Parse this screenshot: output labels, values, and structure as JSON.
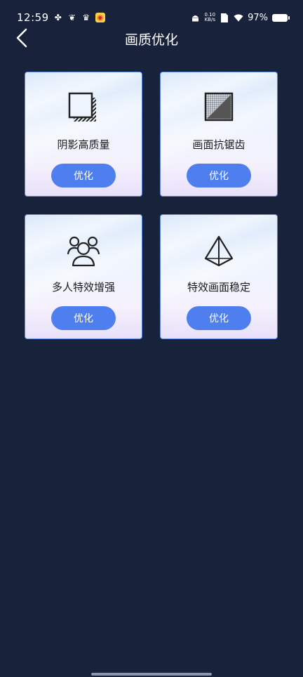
{
  "status_bar": {
    "time": "12:59",
    "net_speed_value": "0.10",
    "net_speed_unit": "KB/s",
    "battery": "97%"
  },
  "header": {
    "title": "画质优化"
  },
  "cards": [
    {
      "label": "阴影高质量",
      "button": "优化",
      "icon": "shadow-square-icon"
    },
    {
      "label": "画面抗锯齿",
      "button": "优化",
      "icon": "antialias-grid-icon"
    },
    {
      "label": "多人特效增强",
      "button": "优化",
      "icon": "multi-user-icon"
    },
    {
      "label": "特效画面稳定",
      "button": "优化",
      "icon": "pyramid-icon"
    }
  ],
  "colors": {
    "background": "#18223a",
    "button": "#4f7fee",
    "card_border": "#5a88e6"
  }
}
